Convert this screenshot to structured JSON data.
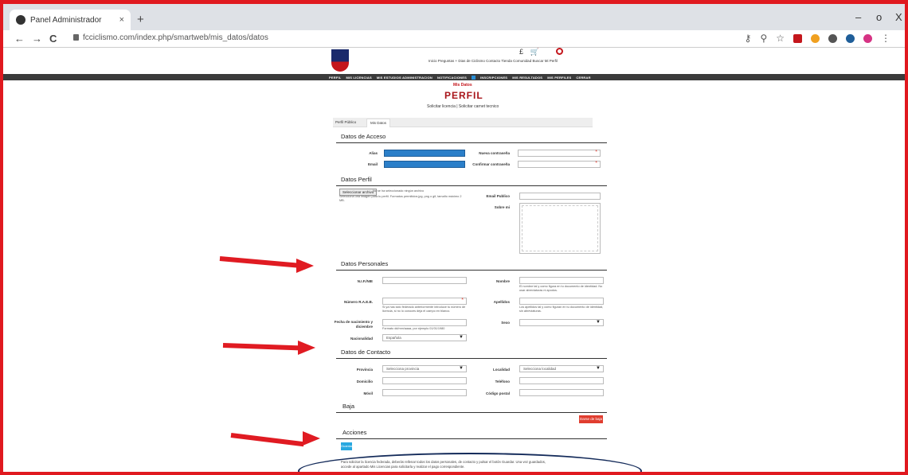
{
  "browser": {
    "tab_title": "Panel Administrador",
    "tab_close": "×",
    "new_tab": "+",
    "url": "fcciclismo.com/index.php/smartweb/mis_datos/datos",
    "back": "←",
    "forward": "→",
    "reload": "C",
    "minimize": "–",
    "maximize": "o",
    "close": "X"
  },
  "site": {
    "top_icons": "£ 🛒",
    "top_links": "Inicio  Preguntas + Dias de Ciclismo  Contacto  Tienda  Comunidad  Buscar  Mi Perfil",
    "nav": [
      "PERFIL",
      "MIS LICENCIAS",
      "MIS ESTUDIOS ADMINISTRACION",
      "NOTIFICACIONES",
      "INSCRIPCIONES",
      "MIS RESULTADOS",
      "MIS PERFILES",
      "CERRAR"
    ]
  },
  "page": {
    "breadcrumb": "Mis Datos",
    "title": "PERFIL",
    "links": "Solicitar licencia  |  Solicitar carnet tecnico",
    "tabs": [
      "Perfil Público",
      "Mis Datos"
    ]
  },
  "acceso": {
    "title": "Datos de Acceso",
    "user_label": "Alias",
    "email_label": "Email",
    "new_pass_label": "Nueva contraseña",
    "confirm_pass_label": "Confirmar contraseña",
    "req": "*"
  },
  "perfil": {
    "title": "Datos Perfil",
    "file_button": "Seleccionar archivo",
    "file_status": "No se ha seleccionado ningún archivo",
    "file_hint": "Selecciona una imagen para tu perfil. Formatos permitidos jpg, png o gif, tamaño máximo 2 MB.",
    "email_public_label": "Email Publico",
    "about_label": "Sobre mi"
  },
  "personales": {
    "title": "Datos Personales",
    "nif_label": "N.I.F./NIE",
    "nombre_label": "Nombre",
    "nombre_hint": "El nombre tal y como figura en tu documento de identidad. No usar abreviaturas ni apodos.",
    "numero_label": "Número R.A.E.B.",
    "numero_hint": "Si ya has sido federado anteriormente introduce tu número de licencia, si no lo conoces deja el campo en blanco.",
    "apellidos_label": "Apellidos",
    "apellidos_hint": "Los apellidos tal y como figuran en tu documento de identidad, sin abreviaturas.",
    "fecha_label": "Fecha de nacimiento y diciembre",
    "fecha_hint": "Formato dd/mm/aaaa, por ejemplo 01/01/1980",
    "sexo_label": "Sexo",
    "nacionalidad_label": "Nacionalidad",
    "nacionalidad_value": "Española",
    "caret": "▼",
    "req": "*"
  },
  "contacto": {
    "title": "Datos de Contacto",
    "provincia_label": "Provincia",
    "provincia_value": "Selecciona provincia",
    "localidad_label": "Localidad",
    "localidad_value": "Selecciona localidad",
    "domicilio_label": "Domicilio",
    "telefono_label": "Teléfono",
    "movil_label": "Móvil",
    "cp_label": "Código postal",
    "caret": "▼"
  },
  "baja": {
    "title": "Baja",
    "button": "Darse de baja"
  },
  "acciones": {
    "title": "Acciones",
    "button": "Guardar"
  },
  "footnote": {
    "line1": "Para solicitar la licencia federada, deberás rellenar todos los datos personales, de contacto y pulsar el botón Guardar. Una vez guardados,",
    "line2": "accede al apartado Mis Licencias para solicitarla y realizar el pago correspondiente."
  },
  "colors": {
    "brand_red": "#a8141a",
    "arrow_red": "#e01b22",
    "accent_blue": "#29a8e0",
    "ellipse_navy": "#142b5a"
  }
}
